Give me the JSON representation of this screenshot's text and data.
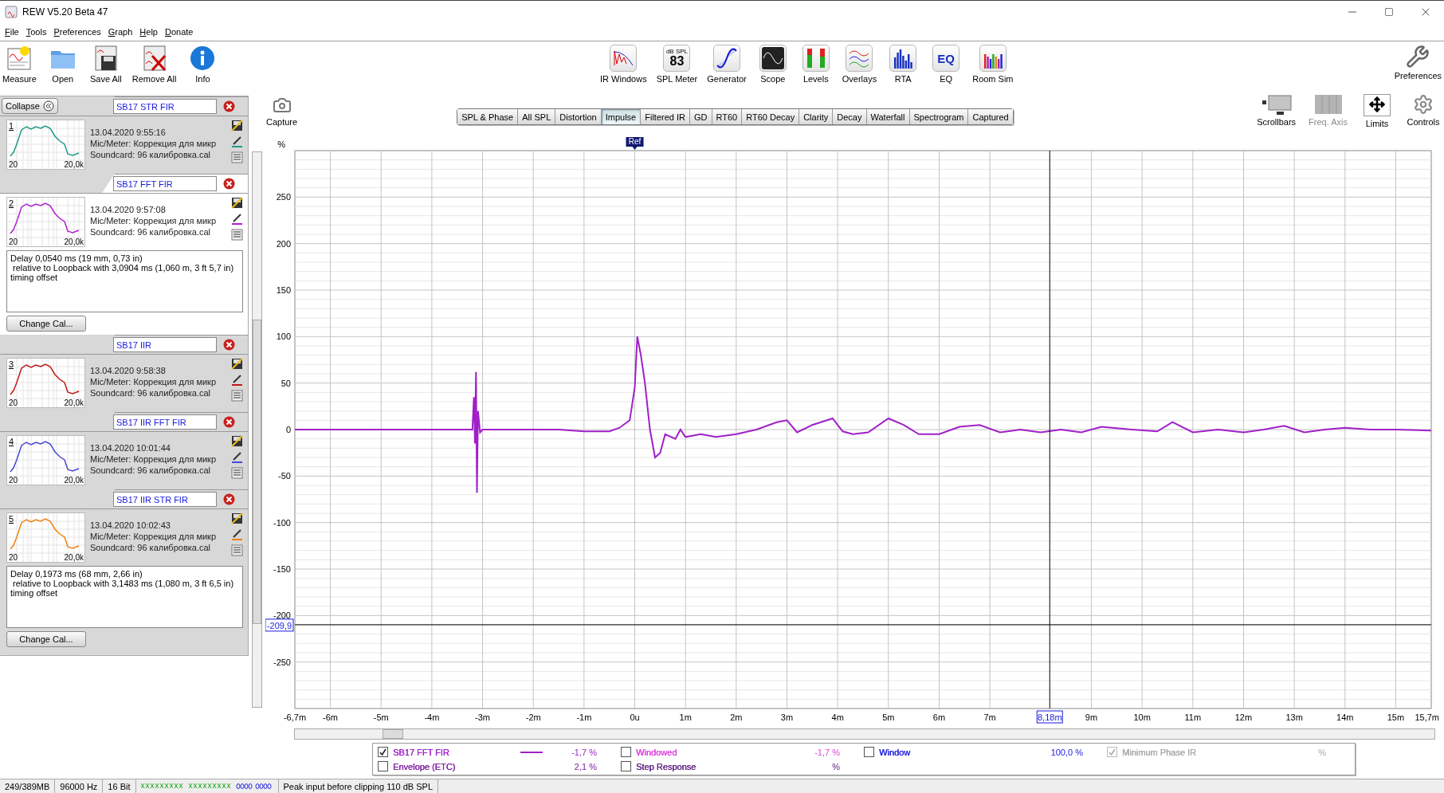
{
  "window": {
    "title": "REW V5.20 Beta 47"
  },
  "menu": [
    "File",
    "Tools",
    "Preferences",
    "Graph",
    "Help",
    "Donate"
  ],
  "toolbar": {
    "left": [
      {
        "kind": "measure",
        "label": "Measure"
      },
      {
        "kind": "open",
        "label": "Open"
      },
      {
        "kind": "save-all",
        "label": "Save All"
      },
      {
        "kind": "remove-all",
        "label": "Remove All"
      },
      {
        "kind": "info",
        "label": "Info"
      }
    ],
    "center": [
      {
        "kind": "ir-windows",
        "label": "IR Windows"
      },
      {
        "kind": "spl-meter",
        "label": "SPL Meter",
        "icon_caption": "dB SPL",
        "icon_value": "83"
      },
      {
        "kind": "generator",
        "label": "Generator"
      },
      {
        "kind": "scope",
        "label": "Scope"
      },
      {
        "kind": "levels",
        "label": "Levels"
      },
      {
        "kind": "overlays",
        "label": "Overlays"
      },
      {
        "kind": "rta",
        "label": "RTA"
      },
      {
        "kind": "eq",
        "label": "EQ",
        "icon_value": "EQ"
      },
      {
        "kind": "room-sim",
        "label": "Room Sim"
      }
    ],
    "right": [
      {
        "kind": "preferences",
        "label": "Preferences"
      }
    ]
  },
  "graph_toolbar": {
    "capture": "Capture",
    "tabs": [
      {
        "label": "SPL & Phase",
        "selected": false
      },
      {
        "label": "All SPL",
        "selected": false
      },
      {
        "label": "Distortion",
        "selected": false
      },
      {
        "label": "Impulse",
        "selected": true
      },
      {
        "label": "Filtered IR",
        "selected": false
      },
      {
        "label": "GD",
        "selected": false
      },
      {
        "label": "RT60",
        "selected": false
      },
      {
        "label": "RT60 Decay",
        "selected": false
      },
      {
        "label": "Clarity",
        "selected": false
      },
      {
        "label": "Decay",
        "selected": false
      },
      {
        "label": "Waterfall",
        "selected": false
      },
      {
        "label": "Spectrogram",
        "selected": false
      },
      {
        "label": "Captured",
        "selected": false
      }
    ],
    "tools": [
      {
        "kind": "scrollbars",
        "label": "Scrollbars",
        "disabled": false
      },
      {
        "kind": "freq-axis",
        "label": "Freq. Axis",
        "disabled": true
      },
      {
        "kind": "limits",
        "label": "Limits",
        "disabled": false
      },
      {
        "kind": "controls",
        "label": "Controls",
        "disabled": false
      }
    ]
  },
  "measurements_panel": {
    "collapse_button": "Collapse",
    "items": [
      {
        "number": "1",
        "name": "SB17 STR FIR",
        "color": "#1f9a8a",
        "expanded": false,
        "selected": false,
        "date": "13.04.2020 9:55:16",
        "mic": "Mic/Meter: Коррекция для микр",
        "soundcard": "Soundcard: 96 калибровка.cal",
        "axis_min": "20",
        "axis_max": "20,0k"
      },
      {
        "number": "2",
        "name": "SB17 FFT FIR",
        "color": "#b020d0",
        "expanded": true,
        "selected": true,
        "date": "13.04.2020 9:57:08",
        "mic": "Mic/Meter: Коррекция для микр",
        "soundcard": "Soundcard: 96 калибровка.cal",
        "axis_min": "20",
        "axis_max": "20,0k",
        "delay": "Delay 0,0540 ms (19 mm, 0,73 in)\n relative to Loopback with 3,0904 ms (1,060 m, 3 ft 5,7 in)\ntiming offset",
        "change_cal": "Change Cal..."
      },
      {
        "number": "3",
        "name": "SB17 IIR",
        "color": "#c01818",
        "expanded": false,
        "selected": false,
        "date": "13.04.2020 9:58:38",
        "mic": "Mic/Meter: Коррекция для микр",
        "soundcard": "Soundcard: 96 калибровка.cal",
        "axis_min": "20",
        "axis_max": "20,0k"
      },
      {
        "number": "4",
        "name": "SB17 IIR FFT FIR",
        "color": "#4848d8",
        "expanded": false,
        "selected": false,
        "date": "13.04.2020 10:01:44",
        "mic": "Mic/Meter: Коррекция для микр",
        "soundcard": "Soundcard: 96 калибровка.cal",
        "axis_min": "20",
        "axis_max": "20,0k"
      },
      {
        "number": "5",
        "name": "SB17 IIR STR FIR",
        "color": "#f08010",
        "expanded": true,
        "selected": false,
        "date": "13.04.2020 10:02:43",
        "mic": "Mic/Meter: Коррекция для микр",
        "soundcard": "Soundcard: 96 калибровка.cal",
        "axis_min": "20",
        "axis_max": "20,0k",
        "delay": "Delay 0,1973 ms (68 mm, 2,66 in)\n relative to Loopback with 3,1483 ms (1,080 m, 3 ft 6,5 in)\ntiming offset",
        "change_cal": "Change Cal..."
      }
    ]
  },
  "graph": {
    "chart_data": {
      "type": "line",
      "ylabel": "%",
      "x": [
        -6.7,
        -5,
        -3.6,
        -3.2,
        -3.17,
        -3.15,
        -3.13,
        -3.11,
        -3.09,
        -3.05,
        -3.0,
        -1.5,
        -1,
        -0.5,
        -0.3,
        -0.1,
        0,
        0.05,
        0.12,
        0.2,
        0.3,
        0.35,
        0.4,
        0.5,
        0.6,
        0.8,
        0.9,
        1.0,
        1.3,
        1.6,
        2,
        2.4,
        2.8,
        3.0,
        3.2,
        3.5,
        3.9,
        4.1,
        4.3,
        4.6,
        5.0,
        5.3,
        5.6,
        6.0,
        6.4,
        6.8,
        7.2,
        7.6,
        8.0,
        8.4,
        8.8,
        9.2,
        9.8,
        10.3,
        10.6,
        11.0,
        11.5,
        12.0,
        12.4,
        12.8,
        13.2,
        13.6,
        14.0,
        14.5,
        15,
        15.7
      ],
      "series": [
        {
          "color": "#a020c8",
          "values": [
            0,
            0,
            0,
            0,
            35,
            -15,
            62,
            -68,
            20,
            -3,
            0,
            0,
            -2,
            -2,
            2,
            10,
            45,
            100,
            80,
            50,
            0,
            -15,
            -30,
            -25,
            -5,
            -10,
            0,
            -8,
            -5,
            -8,
            -5,
            0,
            8,
            10,
            -3,
            5,
            12,
            -2,
            -5,
            -3,
            12,
            5,
            -5,
            -5,
            3,
            5,
            -3,
            0,
            -3,
            0,
            -3,
            3,
            0,
            -2,
            8,
            -3,
            0,
            -3,
            0,
            4,
            -3,
            0,
            2,
            0,
            0,
            -1
          ]
        }
      ],
      "xlim": [
        -6.7,
        15.7
      ],
      "ylim": [
        -300,
        300
      ],
      "xticks": [
        {
          "value": -6.7,
          "label": "-6,7m"
        },
        {
          "value": -6,
          "label": "-6m"
        },
        {
          "value": -5,
          "label": "-5m"
        },
        {
          "value": -4,
          "label": "-4m"
        },
        {
          "value": -3,
          "label": "-3m"
        },
        {
          "value": -2,
          "label": "-2m"
        },
        {
          "value": -1,
          "label": "-1m"
        },
        {
          "value": 0,
          "label": "0u"
        },
        {
          "value": 1,
          "label": "1m"
        },
        {
          "value": 2,
          "label": "2m"
        },
        {
          "value": 3,
          "label": "3m"
        },
        {
          "value": 4,
          "label": "4m"
        },
        {
          "value": 5,
          "label": "5m"
        },
        {
          "value": 6,
          "label": "6m"
        },
        {
          "value": 7,
          "label": "7m"
        },
        {
          "value": 9,
          "label": "9m"
        },
        {
          "value": 10,
          "label": "10m"
        },
        {
          "value": 11,
          "label": "11m"
        },
        {
          "value": 12,
          "label": "12m"
        },
        {
          "value": 13,
          "label": "13m"
        },
        {
          "value": 14,
          "label": "14m"
        },
        {
          "value": 15,
          "label": "15m"
        },
        {
          "value": 15.7,
          "label": "15,7m"
        }
      ],
      "yticks": [
        -250,
        -200,
        -150,
        -100,
        -50,
        0,
        50,
        100,
        150,
        200,
        250
      ],
      "grid": true,
      "ref_lines": [
        {
          "axis": "x",
          "value": 8.18,
          "label": "8,18m"
        },
        {
          "axis": "y",
          "value": -209.9,
          "label": "-209,9"
        }
      ],
      "annotations": [
        "Ref"
      ]
    }
  },
  "legend": {
    "items": [
      {
        "label": "SB17 FFT FIR",
        "color": "#a020c8",
        "checked": true,
        "disabled": false,
        "value": "-1,7 %"
      },
      {
        "label": "Windowed",
        "color": "#e040e0",
        "checked": false,
        "disabled": false,
        "value": "-1,7 %"
      },
      {
        "label": "Window",
        "color": "#2020e0",
        "checked": false,
        "disabled": false,
        "value": "100,0 %"
      },
      {
        "label": "Minimum Phase IR",
        "color": "#a8a8a8",
        "checked": true,
        "disabled": true,
        "value": "%"
      },
      {
        "label": "Envelope (ETC)",
        "color": "#8020a0",
        "checked": false,
        "disabled": false,
        "value": "2,1 %"
      },
      {
        "label": "Step Response",
        "color": "#602080",
        "checked": false,
        "disabled": false,
        "value": "%"
      }
    ]
  },
  "status_bar": [
    {
      "kind": "text",
      "text": "249/389MB"
    },
    {
      "kind": "text",
      "text": "96000 Hz"
    },
    {
      "kind": "text",
      "text": "16 Bit"
    },
    {
      "kind": "meter"
    },
    {
      "kind": "text",
      "text": "Peak input before clipping 110 dB SPL"
    }
  ]
}
